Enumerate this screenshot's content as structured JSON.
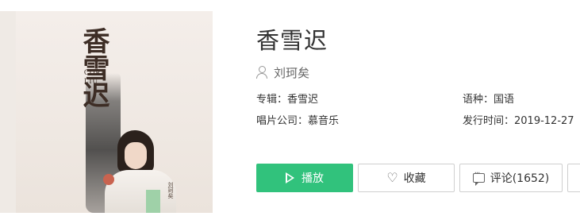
{
  "song": {
    "title": "香雪迟",
    "artist": "刘珂矣"
  },
  "cover": {
    "calligraphy": "香雪迟",
    "english_line1": "CORI",
    "english_line2": "LIU",
    "stamp_text": "刘珂矣"
  },
  "meta": {
    "album_label": "专辑：",
    "album_value": "香雪迟",
    "language_label": "语种：",
    "language_value": "国语",
    "company_label": "唱片公司：",
    "company_value": "慕音乐",
    "release_label": "发行时间：",
    "release_value": "2019-12-27"
  },
  "actions": {
    "play_label": "播放",
    "favorite_label": "收藏",
    "comment_label": "评论(1652)"
  },
  "colors": {
    "primary_green": "#31c27c",
    "text": "#333333",
    "muted": "#666666",
    "border": "#cfcfcf"
  },
  "icons": [
    "play-icon",
    "heart-icon",
    "comment-icon",
    "user-icon"
  ]
}
